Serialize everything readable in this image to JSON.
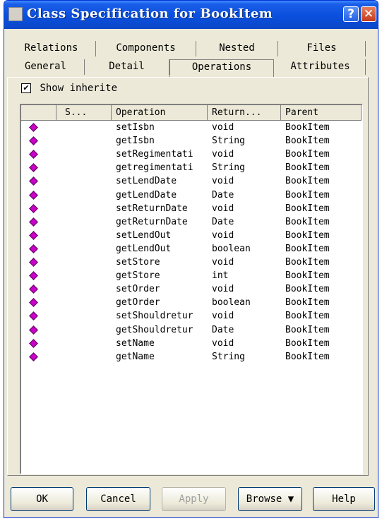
{
  "window": {
    "title": "Class Specification for BookItem",
    "help_glyph": "?",
    "close_glyph": "✕"
  },
  "tabs": {
    "row1": [
      "Relations",
      "Components",
      "Nested",
      "Files"
    ],
    "row2": [
      "General",
      "Detail",
      "Operations",
      "Attributes"
    ],
    "selected": "Operations"
  },
  "options": {
    "show_inherited_label": "Show inherite",
    "show_inherited_checked": true,
    "check_glyph": "✔"
  },
  "table": {
    "columns": [
      "",
      "S...",
      "Operation",
      "Return...",
      "Parent"
    ],
    "rows": [
      {
        "operation": "setIsbn",
        "return": "void",
        "parent": "BookItem"
      },
      {
        "operation": "getIsbn",
        "return": "String",
        "parent": "BookItem"
      },
      {
        "operation": "setRegimentati",
        "return": "void",
        "parent": "BookItem"
      },
      {
        "operation": "getregimentati",
        "return": "String",
        "parent": "BookItem"
      },
      {
        "operation": "setLendDate",
        "return": "void",
        "parent": "BookItem"
      },
      {
        "operation": "getLendDate",
        "return": "Date",
        "parent": "BookItem"
      },
      {
        "operation": "setReturnDate",
        "return": "void",
        "parent": "BookItem"
      },
      {
        "operation": "getReturnDate",
        "return": "Date",
        "parent": "BookItem"
      },
      {
        "operation": "setLendOut",
        "return": "void",
        "parent": "BookItem"
      },
      {
        "operation": "getLendOut",
        "return": "boolean",
        "parent": "BookItem"
      },
      {
        "operation": "setStore",
        "return": "void",
        "parent": "BookItem"
      },
      {
        "operation": "getStore",
        "return": "int",
        "parent": "BookItem"
      },
      {
        "operation": "setOrder",
        "return": "void",
        "parent": "BookItem"
      },
      {
        "operation": "getOrder",
        "return": "boolean",
        "parent": "BookItem"
      },
      {
        "operation": "setShouldretur",
        "return": "void",
        "parent": "BookItem"
      },
      {
        "operation": "getShouldretur",
        "return": "Date",
        "parent": "BookItem"
      },
      {
        "operation": "setName",
        "return": "void",
        "parent": "BookItem"
      },
      {
        "operation": "getName",
        "return": "String",
        "parent": "BookItem"
      }
    ],
    "row_icon": "operation-diamond-icon",
    "icon_color": "#c800c8"
  },
  "buttons": {
    "ok": "OK",
    "cancel": "Cancel",
    "apply": "Apply",
    "browse": "Browse ▼",
    "help": "Help"
  }
}
